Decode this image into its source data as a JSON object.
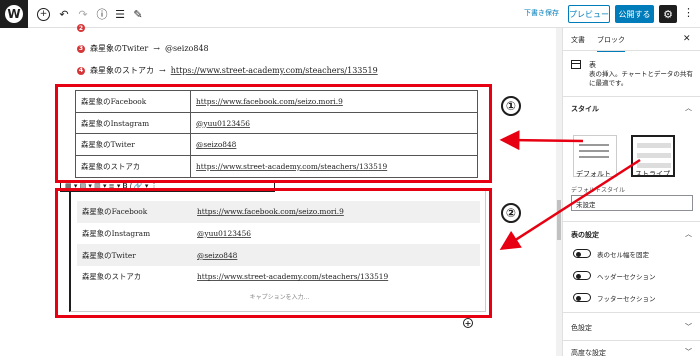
{
  "topbar": {
    "logo": "W",
    "tools": [
      "add-icon",
      "undo-icon",
      "redo-icon",
      "info-icon",
      "list-view-icon",
      "edit-icon"
    ],
    "save_draft": "下書き保存",
    "preview": "プレビュー",
    "publish": "公開する"
  },
  "list_items": [
    {
      "num": "3",
      "name": "森星象のTwiter",
      "value": "@seizo848"
    },
    {
      "num": "4",
      "name": "森星象のストアカ",
      "value": "https://www.street-academy.com/steachers/133519"
    }
  ],
  "arrow": "→",
  "table_rows": [
    {
      "name": "森星象のFacebook",
      "value": "https://www.facebook.com/seizo.mori.9"
    },
    {
      "name": "森星象のInstagram",
      "value": "@yuu0123456"
    },
    {
      "name": "森星象のTwiter",
      "value": "@seizo848"
    },
    {
      "name": "森星象のストアカ",
      "value": "https://www.street-academy.com/steachers/133519"
    }
  ],
  "caption_placeholder": "キャプションを入力...",
  "annotations": {
    "one": "①",
    "two": "②"
  },
  "sidebar": {
    "tab_doc": "文書",
    "tab_block": "ブロック",
    "block_name": "表",
    "block_desc": "表の挿入。チャートとデータの共有に最適です。",
    "style_heading": "スタイル",
    "style_default": "デフォルト",
    "style_stripe": "ストライプ",
    "default_style_label": "デフォルトスタイル",
    "default_style_value": "未設定",
    "table_settings": "表の設定",
    "toggles": [
      "表のセル幅を固定",
      "ヘッダーセクション",
      "フッターセクション"
    ],
    "color_settings": "色設定",
    "advanced": "高度な設定"
  },
  "colors": {
    "accent": "#007cba",
    "annotation": "#e60012"
  }
}
